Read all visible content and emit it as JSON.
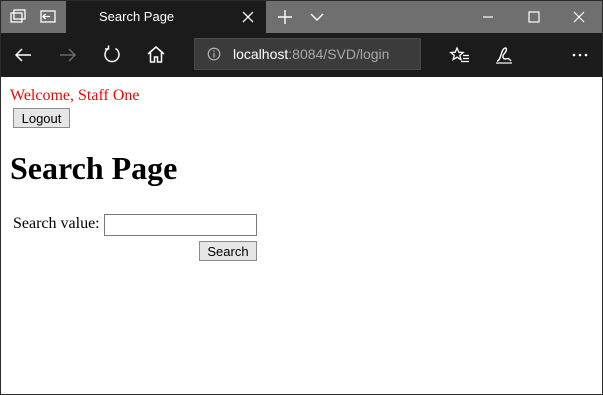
{
  "browser": {
    "tab_title": "Search Page",
    "address_host": "localhost",
    "address_path": ":8084/SVD/login",
    "icons": [
      "tabs-icon",
      "set-aside-tabs-icon",
      "close-icon",
      "new-tab-icon",
      "chevron-down-icon",
      "minimize-icon",
      "maximize-icon",
      "close-icon",
      "back-icon",
      "forward-icon",
      "refresh-icon",
      "home-icon",
      "info-icon",
      "favorites-icon",
      "notes-icon",
      "more-icon"
    ]
  },
  "page": {
    "welcome": "Welcome, Staff One",
    "logout_label": "Logout",
    "heading": "Search Page",
    "search_label": "Search value:",
    "search_value": "",
    "search_button": "Search"
  },
  "colors": {
    "welcome_text": "#ff0000",
    "tab_bar": "#6f6f6f",
    "nav_bar": "#1b1b1b"
  }
}
